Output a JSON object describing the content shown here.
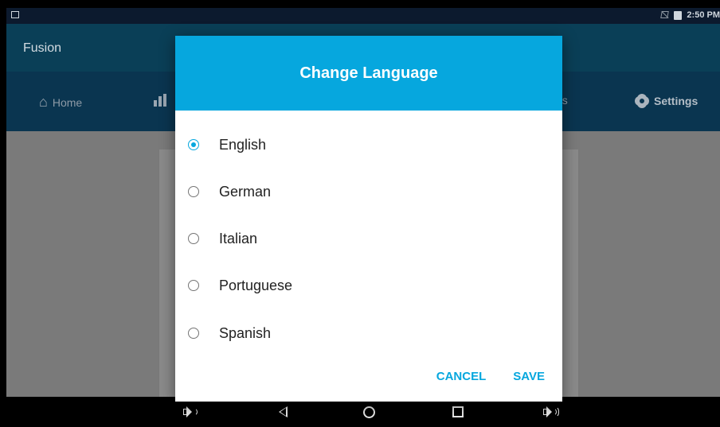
{
  "status_bar": {
    "time": "2:50 PM",
    "icons": [
      "screenshot-icon",
      "no-sim-icon",
      "battery-charging-icon"
    ]
  },
  "app": {
    "title": "Fusion"
  },
  "tabs": [
    {
      "label": "Home",
      "icon": "home-icon"
    },
    {
      "label": "",
      "icon": "bar-chart-icon"
    },
    {
      "label": "gs",
      "icon": ""
    },
    {
      "label": "Settings",
      "icon": "gear-icon",
      "selected": true
    }
  ],
  "dialog": {
    "title": "Change Language",
    "options": [
      {
        "label": "English",
        "selected": true
      },
      {
        "label": "German",
        "selected": false
      },
      {
        "label": "Italian",
        "selected": false
      },
      {
        "label": "Portuguese",
        "selected": false
      },
      {
        "label": "Spanish",
        "selected": false
      }
    ],
    "cancel_label": "CANCEL",
    "save_label": "SAVE"
  },
  "nav_bar": {
    "buttons": [
      "volume-down-icon",
      "back-icon",
      "home-circle-icon",
      "recent-apps-icon",
      "volume-up-icon"
    ]
  },
  "colors": {
    "accent": "#06a7de",
    "app_bar": "#0a3f57",
    "tab_bar": "#0a3550",
    "scrim": "#7a7a7a"
  }
}
